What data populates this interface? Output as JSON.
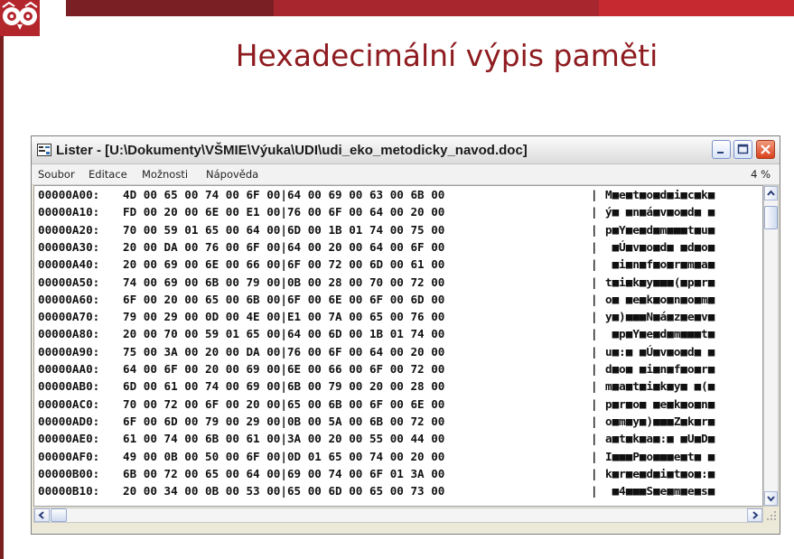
{
  "slide": {
    "title": "Hexadecimální výpis paměti"
  },
  "window": {
    "title": "Lister - [U:\\Dokumenty\\VŠMIE\\Výuka\\UDI\\udi_eko_metodicky_navod.doc]",
    "menu": [
      "Soubor",
      "Editace",
      "Možnosti",
      "Nápověda"
    ],
    "percent": "4 %"
  },
  "rows": [
    {
      "addr": "00000A00:",
      "bytes": "4D 00 65 00 74 00 6F 00|64 00 69 00 63 00 6B 00",
      "ascii": "M■e■t■o■d■i■c■k■"
    },
    {
      "addr": "00000A10:",
      "bytes": "FD 00 20 00 6E 00 E1 00|76 00 6F 00 64 00 20 00",
      "ascii": "ý■ ■n■á■v■o■d■ ■"
    },
    {
      "addr": "00000A20:",
      "bytes": "70 00 59 01 65 00 64 00|6D 00 1B 01 74 00 75 00",
      "ascii": "p■Y■e■d■m■■■t■u■"
    },
    {
      "addr": "00000A30:",
      "bytes": "20 00 DA 00 76 00 6F 00|64 00 20 00 64 00 6F 00",
      "ascii": " ■Ú■v■o■d■ ■d■o■"
    },
    {
      "addr": "00000A40:",
      "bytes": "20 00 69 00 6E 00 66 00|6F 00 72 00 6D 00 61 00",
      "ascii": " ■i■n■f■o■r■m■a■"
    },
    {
      "addr": "00000A50:",
      "bytes": "74 00 69 00 6B 00 79 00|0B 00 28 00 70 00 72 00",
      "ascii": "t■i■k■y■■■(■p■r■"
    },
    {
      "addr": "00000A60:",
      "bytes": "6F 00 20 00 65 00 6B 00|6F 00 6E 00 6F 00 6D 00",
      "ascii": "o■ ■e■k■o■n■o■m■"
    },
    {
      "addr": "00000A70:",
      "bytes": "79 00 29 00 0D 00 4E 00|E1 00 7A 00 65 00 76 00",
      "ascii": "y■)■■■N■á■z■e■v■"
    },
    {
      "addr": "00000A80:",
      "bytes": "20 00 70 00 59 01 65 00|64 00 6D 00 1B 01 74 00",
      "ascii": " ■p■Y■e■d■m■■■t■"
    },
    {
      "addr": "00000A90:",
      "bytes": "75 00 3A 00 20 00 DA 00|76 00 6F 00 64 00 20 00",
      "ascii": "u■:■ ■Ú■v■o■d■ ■"
    },
    {
      "addr": "00000AA0:",
      "bytes": "64 00 6F 00 20 00 69 00|6E 00 66 00 6F 00 72 00",
      "ascii": "d■o■ ■i■n■f■o■r■"
    },
    {
      "addr": "00000AB0:",
      "bytes": "6D 00 61 00 74 00 69 00|6B 00 79 00 20 00 28 00",
      "ascii": "m■a■t■i■k■y■ ■(■"
    },
    {
      "addr": "00000AC0:",
      "bytes": "70 00 72 00 6F 00 20 00|65 00 6B 00 6F 00 6E 00",
      "ascii": "p■r■o■ ■e■k■o■n■"
    },
    {
      "addr": "00000AD0:",
      "bytes": "6F 00 6D 00 79 00 29 00|0B 00 5A 00 6B 00 72 00",
      "ascii": "o■m■y■)■■■Z■k■r■"
    },
    {
      "addr": "00000AE0:",
      "bytes": "61 00 74 00 6B 00 61 00|3A 00 20 00 55 00 44 00",
      "ascii": "a■t■k■a■:■ ■U■D■"
    },
    {
      "addr": "00000AF0:",
      "bytes": "49 00 0B 00 50 00 6F 00|0D 01 65 00 74 00 20 00",
      "ascii": "I■■■P■o■■■e■t■ ■"
    },
    {
      "addr": "00000B00:",
      "bytes": "6B 00 72 00 65 00 64 00|69 00 74 00 6F 01 3A 00",
      "ascii": "k■r■e■d■i■t■o■:■"
    },
    {
      "addr": "00000B10:",
      "bytes": "20 00 34 00 0B 00 53 00|65 00 6D 00 65 00 73 00",
      "ascii": " ■4■■■S■e■m■e■s■"
    }
  ]
}
